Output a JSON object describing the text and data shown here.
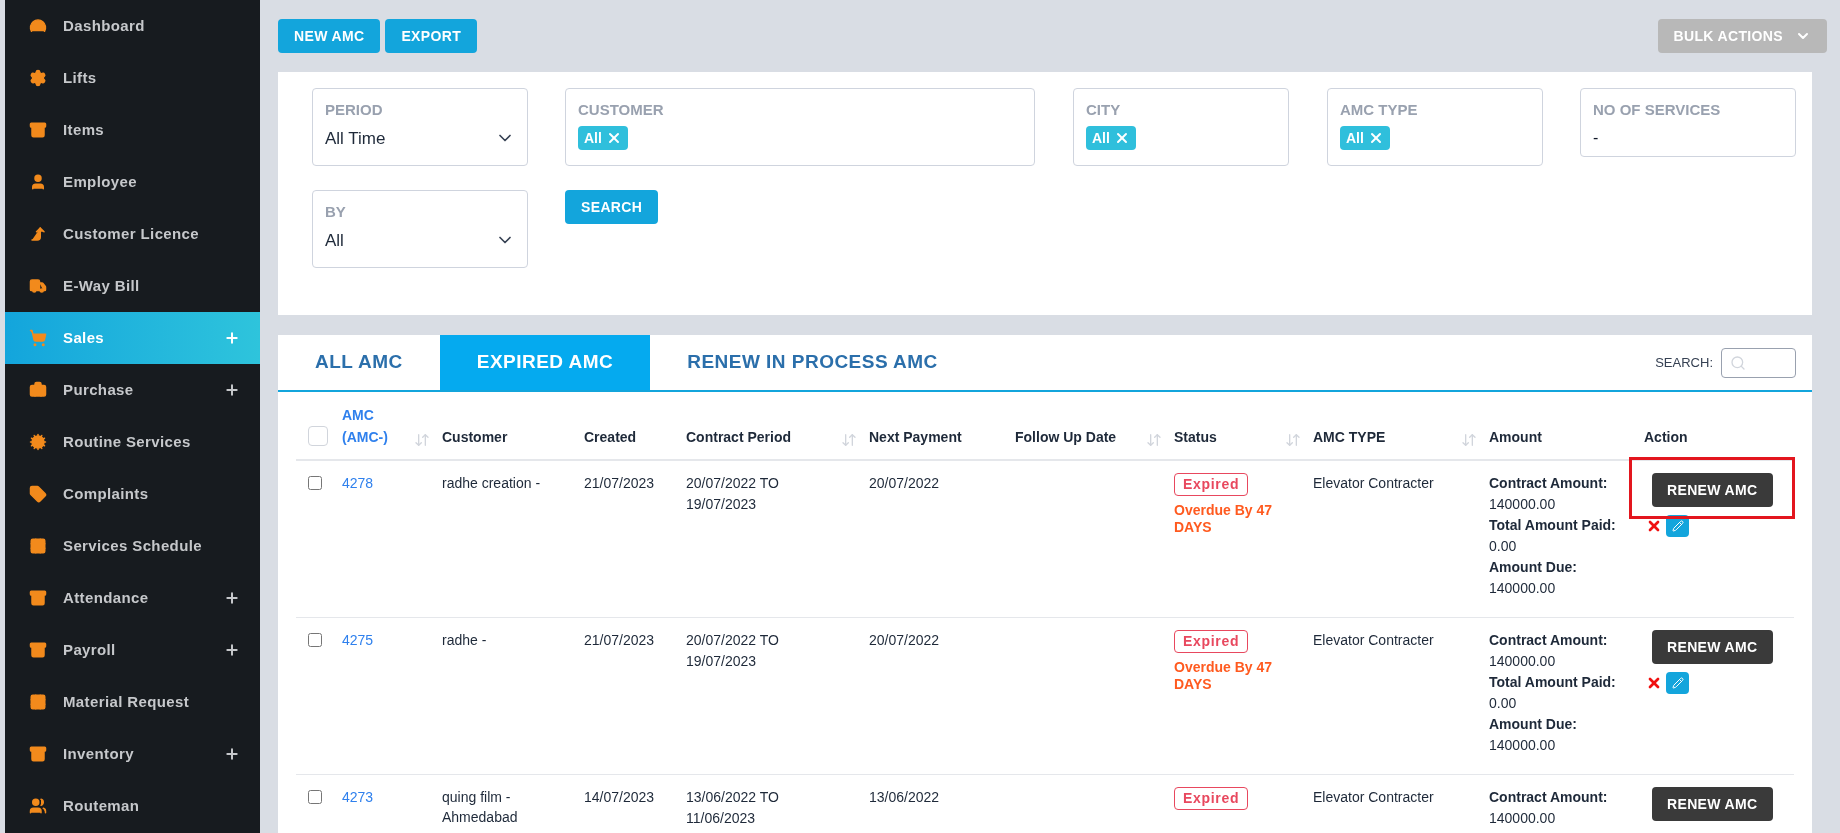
{
  "sidebar": {
    "items": [
      {
        "label": "Dashboard",
        "selected": false,
        "expandable": false
      },
      {
        "label": "Lifts",
        "selected": false,
        "expandable": false
      },
      {
        "label": "Items",
        "selected": false,
        "expandable": false
      },
      {
        "label": "Employee",
        "selected": false,
        "expandable": false
      },
      {
        "label": "Customer Licence",
        "selected": false,
        "expandable": false
      },
      {
        "label": "E-Way Bill",
        "selected": false,
        "expandable": false
      },
      {
        "label": "Sales",
        "selected": true,
        "expandable": true
      },
      {
        "label": "Purchase",
        "selected": false,
        "expandable": true
      },
      {
        "label": "Routine Services",
        "selected": false,
        "expandable": false
      },
      {
        "label": "Complaints",
        "selected": false,
        "expandable": false
      },
      {
        "label": "Services Schedule",
        "selected": false,
        "expandable": false
      },
      {
        "label": "Attendance",
        "selected": false,
        "expandable": true
      },
      {
        "label": "Payroll",
        "selected": false,
        "expandable": true
      },
      {
        "label": "Material Request",
        "selected": false,
        "expandable": false
      },
      {
        "label": "Inventory",
        "selected": false,
        "expandable": true
      },
      {
        "label": "Routeman",
        "selected": false,
        "expandable": false
      }
    ]
  },
  "toolbar": {
    "buttons": [
      "NEW AMC",
      "EXPORT"
    ],
    "bulk_actions": "BULK ACTIONS"
  },
  "filters": [
    {
      "kind": "select",
      "label": "PERIOD",
      "value": "All Time"
    },
    {
      "kind": "tags",
      "label": "CUSTOMER",
      "tags": [
        "All"
      ]
    },
    {
      "kind": "tags",
      "label": "CITY",
      "tags": [
        "All"
      ]
    },
    {
      "kind": "tags",
      "label": "AMC TYPE",
      "tags": [
        "All"
      ]
    },
    {
      "kind": "text",
      "label": "NO OF SERVICES",
      "value": "-"
    },
    {
      "kind": "select",
      "label": "BY",
      "value": "All"
    }
  ],
  "search_button": "SEARCH",
  "tabs": [
    {
      "label": "ALL AMC",
      "selected": false
    },
    {
      "label": "EXPIRED AMC",
      "selected": true
    },
    {
      "label": "RENEW IN PROCESS AMC",
      "selected": false
    }
  ],
  "search": {
    "label": "SEARCH:"
  },
  "table": {
    "select_all": {
      "checked": false
    },
    "columns": [
      {
        "label": "AMC (AMC-)",
        "sortable": true
      },
      {
        "label": "Customer",
        "sortable": false
      },
      {
        "label": "Created",
        "sortable": false
      },
      {
        "label": "Contract Period",
        "sortable": true
      },
      {
        "label": "Next Payment",
        "sortable": false
      },
      {
        "label": "Follow Up Date",
        "sortable": true
      },
      {
        "label": "Status",
        "sortable": true
      },
      {
        "label": "AMC TYPE",
        "sortable": true
      },
      {
        "label": "Amount",
        "sortable": false
      },
      {
        "label": "Action",
        "sortable": false
      }
    ],
    "rows": [
      {
        "checked": false,
        "amc": "4278",
        "customer": "radhe creation -",
        "created": "21/07/2023",
        "contract_period": "20/07/2022 TO 19/07/2023",
        "next_payment": "20/07/2022",
        "status": "Expired",
        "overdue": "Overdue By 47 DAYS",
        "amc_type": "Elevator Contracter",
        "amounts": [
          "**Contract Amount:** 140000.00",
          "**Total Amount Paid:** 0.00",
          "**Amount Due:** 140000.00"
        ],
        "action": "RENEW AMC",
        "highlighted": true,
        "row_controls": true
      },
      {
        "checked": false,
        "amc": "4275",
        "customer": "radhe -",
        "created": "21/07/2023",
        "contract_period": "20/07/2022 TO 19/07/2023",
        "next_payment": "20/07/2022",
        "status": "Expired",
        "overdue": "Overdue By 47 DAYS",
        "amc_type": "Elevator Contracter",
        "amounts": [
          "**Contract Amount:** 140000.00",
          "**Total Amount Paid:** 0.00",
          "**Amount Due:** 140000.00"
        ],
        "action": "RENEW AMC",
        "highlighted": false,
        "row_controls": true
      },
      {
        "checked": false,
        "amc": "4273",
        "customer": "quing film - Ahmedabad",
        "created": "14/07/2023",
        "contract_period": "13/06/2022 TO 11/06/2023",
        "next_payment": "13/06/2022",
        "status": "Expired",
        "amc_type": "Elevator Contracter",
        "amounts": [
          "**Contract Amount:** 140000.00"
        ],
        "action": "RENEW AMC",
        "highlighted": false
      }
    ]
  }
}
